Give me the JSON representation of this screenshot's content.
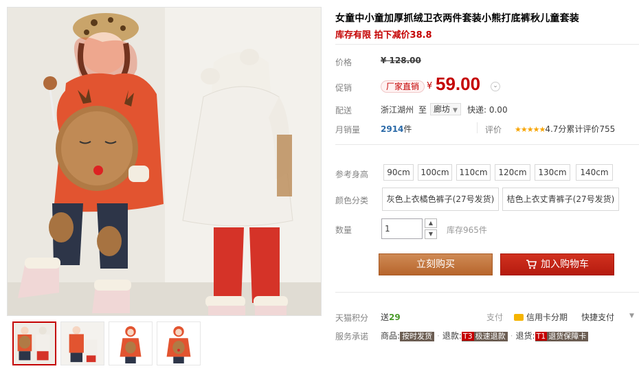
{
  "product": {
    "title": "女童中小童加厚抓绒卫衣两件套装小熊打底裤秋儿童套装",
    "promo": "库存有限 拍下减价38.8"
  },
  "price": {
    "label": "价格",
    "original": "¥ 128.00",
    "promo_label": "促销",
    "tag": "厂家直销",
    "currency": "¥",
    "current": "59.00"
  },
  "shipping": {
    "label": "配送",
    "from": "浙江湖州",
    "to_word": "至",
    "dest": "廊坊",
    "fee": "快递: 0.00"
  },
  "sales": {
    "label": "月销量",
    "count": "2914",
    "unit": "件",
    "review_label": "评价",
    "stars": "★★★★★",
    "score_text": "4.7分累计评价755"
  },
  "sizes": {
    "label": "参考身高",
    "options": [
      "90cm",
      "100cm",
      "110cm",
      "120cm",
      "130cm",
      "140cm"
    ]
  },
  "colors": {
    "label": "颜色分类",
    "options": [
      "灰色上衣橘色裤子(27号发货)",
      "桔色上衣丈青裤子(27号发货)"
    ]
  },
  "quantity": {
    "label": "数量",
    "value": "1",
    "stock": "库存965件"
  },
  "actions": {
    "buy": "立刻购买",
    "cart": "加入购物车"
  },
  "points": {
    "label": "天猫积分",
    "prefix": "送",
    "value": "29",
    "pay_label": "支付",
    "credit": "信用卡分期",
    "quick": "快捷支付"
  },
  "service": {
    "label": "服务承诺",
    "goods_prefix": "商品:",
    "goods_badge": "按时发货",
    "refund_prefix": "退款:",
    "refund_tag": "T3",
    "refund_badge": "极速退款",
    "return_prefix": "退货:",
    "return_tag": "T1",
    "return_badge": "退货保障卡"
  },
  "colors_ui": {
    "price_red": "#c40000",
    "buy_btn": "#c0743f",
    "cart_btn": "#c4281a",
    "link_blue": "#2b6aa8",
    "star_gold": "#f7a400"
  }
}
